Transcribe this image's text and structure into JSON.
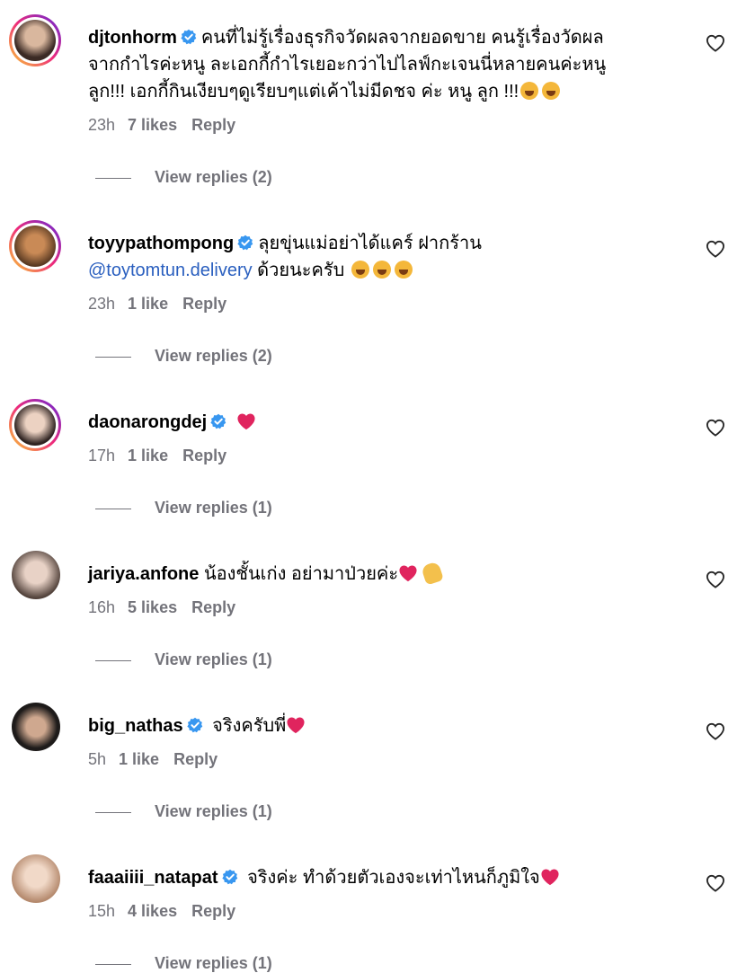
{
  "comments": [
    {
      "username": "djtonhorm",
      "verified": true,
      "text_lines": [
        "คนที่ไม่รู้เรื่องธุรกิจวัดผลจากยอดขาย คนรู้เรื่องวัดผล",
        "จากกำไรค่ะหนู ละเอกกี้กำไรเยอะกว่าไปไลฟ์กะเจนนี่หลายคนค่ะหนู",
        "ลูก!!! เอกกี้กินเงียบๆดูเรียบๆแต่เค้าไม่มีดชจ ค่ะ หนู ลูก !!!"
      ],
      "time": "23h",
      "likes": "7 likes",
      "reply": "Reply",
      "view_replies": "View replies (2)"
    },
    {
      "username": "toyypathompong",
      "verified": true,
      "text_line1": "ลุยขุ่นแม่อย่าได้แคร์ ฝากร้าน",
      "mention": "@toytomtun.delivery",
      "text_line2": "ด้วยนะครับ",
      "time": "23h",
      "likes": "1 like",
      "reply": "Reply",
      "view_replies": "View replies (2)"
    },
    {
      "username": "daonarongdej",
      "verified": true,
      "text": "",
      "time": "17h",
      "likes": "1 like",
      "reply": "Reply",
      "view_replies": "View replies (1)"
    },
    {
      "username": "jariya.anfone",
      "verified": false,
      "text": "น้องชั้นเก่ง อย่ามาป่วยค่ะ",
      "time": "16h",
      "likes": "5 likes",
      "reply": "Reply",
      "view_replies": "View replies (1)"
    },
    {
      "username": "big_nathas",
      "verified": true,
      "text": "จริงครับพี่",
      "time": "5h",
      "likes": "1 like",
      "reply": "Reply",
      "view_replies": "View replies (1)"
    },
    {
      "username": "faaaiiii_natapat",
      "verified": true,
      "text": "จริงค่ะ ทำด้วยตัวเองจะเท่าไหนก็ภูมิใจ",
      "time": "15h",
      "likes": "4 likes",
      "reply": "Reply",
      "view_replies": "View replies (1)"
    }
  ],
  "colors": {
    "verified": "#3897f0",
    "meta_text": "#73737a",
    "mention": "#2a5fbf",
    "heart": "#e0245e"
  }
}
